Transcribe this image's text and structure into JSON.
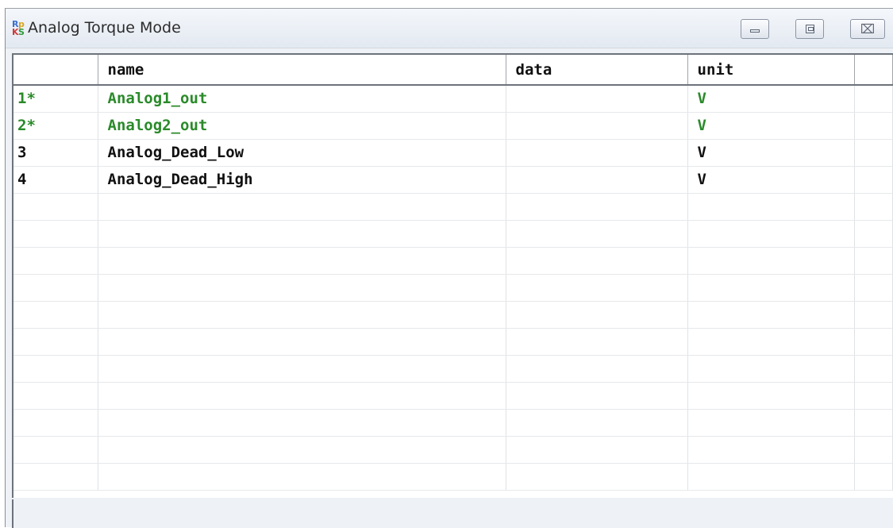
{
  "window": {
    "title": "Analog Torque Mode",
    "icon": "rs-ks-app-icon",
    "buttons": [
      "minimize-icon",
      "maximize-icon",
      "close-icon"
    ],
    "close_label": "⌧"
  },
  "table": {
    "columns": [
      "",
      "name",
      "data",
      "unit"
    ],
    "rows": [
      {
        "index": "1*",
        "name": "Analog1_out",
        "data": "",
        "unit": "V",
        "highlight": true
      },
      {
        "index": "2*",
        "name": "Analog2_out",
        "data": "",
        "unit": "V",
        "highlight": true
      },
      {
        "index": "3",
        "name": "Analog_Dead_Low",
        "data": "",
        "unit": "V",
        "highlight": false
      },
      {
        "index": "4",
        "name": "Analog_Dead_High",
        "data": "",
        "unit": "V",
        "highlight": false
      }
    ],
    "colors": {
      "highlight_text": "#2a8a2a",
      "normal_text": "#111111"
    }
  }
}
